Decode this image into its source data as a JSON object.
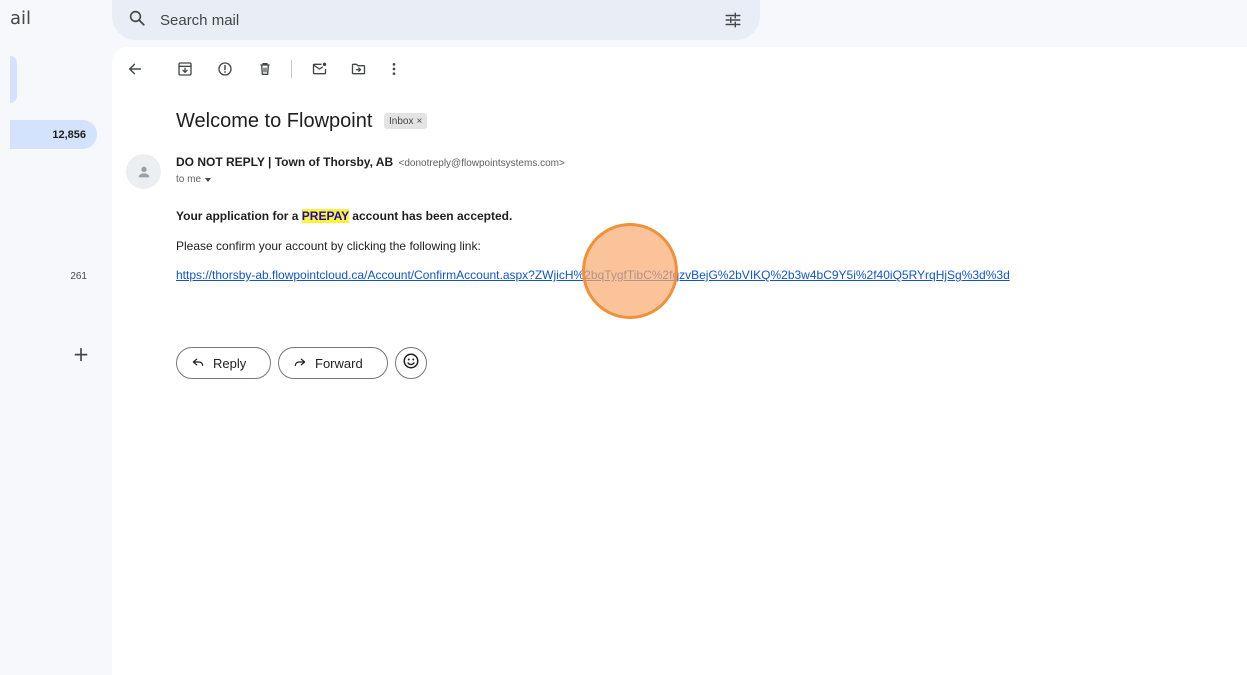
{
  "app": {
    "title_fragment": "ail"
  },
  "nav": {
    "inbox_count": "12,856",
    "other_count": "261",
    "add_label": "+"
  },
  "search": {
    "placeholder": "Search mail"
  },
  "message": {
    "subject": "Welcome to Flowpoint",
    "label_chip": "Inbox",
    "label_chip_close": "×",
    "sender_name": "DO NOT REPLY | Town of Thorsby, AB",
    "sender_email": "<donotreply@flowpointsystems.com>",
    "recipient": "to me",
    "body": {
      "line1_before": "Your application for a ",
      "line1_highlight": "PREPAY",
      "line1_after": " account has been accepted.",
      "line2": "Please confirm your account by clicking the following link:",
      "link": "https://thorsby-ab.flowpointcloud.ca/Account/ConfirmAccount.aspx?ZWjicH%2bqTygfTibC%2fqzvBejG%2bVIKQ%2b3w4bC9Y5i%2f40iQ5RYrqHjSg%3d%3d"
    }
  },
  "actions": {
    "reply_label": "Reply",
    "forward_label": "Forward"
  },
  "icons": {
    "search": "search-icon",
    "filter": "tune-icon",
    "back": "arrow-back-icon",
    "archive": "archive-icon",
    "spam": "report-spam-icon",
    "delete": "trash-icon",
    "unread": "mark-unread-icon",
    "move": "move-to-folder-icon",
    "more": "more-vert-icon",
    "avatar": "person-icon",
    "reply": "reply-icon",
    "forward": "forward-icon",
    "emoji": "emoji-smile-icon"
  },
  "colors": {
    "accent": "#d3e3fd",
    "link": "#1155cc",
    "highlight": "#fff13d",
    "click_marker": "#f0913a"
  }
}
